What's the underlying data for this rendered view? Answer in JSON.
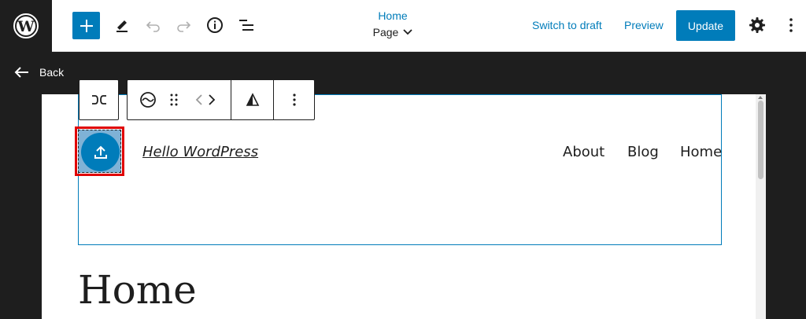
{
  "topbar": {
    "document_title": "Home",
    "document_type": "Page",
    "switch_to_draft": "Switch to draft",
    "preview": "Preview",
    "update": "Update",
    "icons": {
      "logo": "wordpress-logo",
      "add": "plus-icon",
      "tools": "pencil-icon",
      "undo": "undo-icon",
      "redo": "redo-icon",
      "details": "info-icon",
      "outline": "list-view-icon",
      "settings": "gear-icon",
      "options": "more-vertical-icon"
    }
  },
  "back_label": "Back",
  "block_toolbar": {
    "icons": [
      "transform-icon",
      "site-logo-icon",
      "drag-handle-icon",
      "move-left-icon",
      "move-right-icon",
      "alignment-icon",
      "more-options-icon"
    ]
  },
  "site_header": {
    "site_title": "Hello WordPress",
    "nav": [
      "About",
      "Blog",
      "Home"
    ]
  },
  "page_heading": "Home",
  "colors": {
    "accent": "#007cba",
    "dark": "#1e1e1e",
    "highlight_border": "#e00000"
  }
}
